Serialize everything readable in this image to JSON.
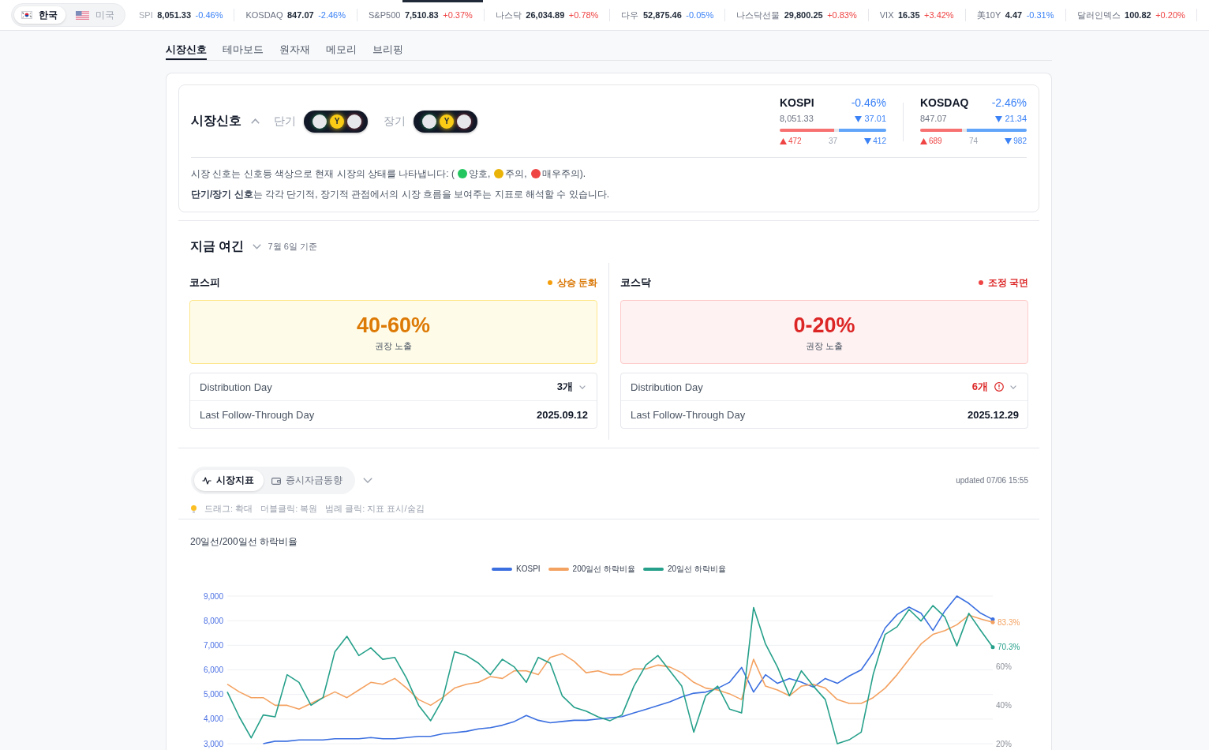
{
  "top_bar": {
    "regions": [
      {
        "label": "한국",
        "kind": "kr",
        "selected": true
      },
      {
        "label": "미국",
        "kind": "us",
        "selected": false
      }
    ],
    "ticker": [
      {
        "label": "SPI",
        "value": "8,051.33",
        "change": "-0.46%",
        "rising": false
      },
      {
        "label": "KOSDAQ",
        "value": "847.07",
        "change": "-2.46%",
        "rising": false
      },
      {
        "label": "S&P500",
        "value": "7,510.83",
        "change": "+0.37%",
        "rising": true
      },
      {
        "label": "나스닥",
        "value": "26,034.89",
        "change": "+0.78%",
        "rising": true
      },
      {
        "label": "다우",
        "value": "52,875.46",
        "change": "-0.05%",
        "rising": false
      },
      {
        "label": "나스닥선물",
        "value": "29,800.25",
        "change": "+0.83%",
        "rising": true
      },
      {
        "label": "VIX",
        "value": "16.35",
        "change": "+3.42%",
        "rising": true
      },
      {
        "label": "美10Y",
        "value": "4.47",
        "change": "-0.31%",
        "rising": false
      },
      {
        "label": "달러인덱스",
        "value": "100.82",
        "change": "+0.20%",
        "rising": true
      }
    ]
  },
  "tabs": [
    {
      "label": "시장신호",
      "selected": true
    },
    {
      "label": "테마보드",
      "selected": false
    },
    {
      "label": "원자재",
      "selected": false
    },
    {
      "label": "메모리",
      "selected": false
    },
    {
      "label": "브리핑",
      "selected": false
    }
  ],
  "market_signal": {
    "title": "시장신호",
    "expanded": true,
    "signals": [
      {
        "label": "단기",
        "lamps": [
          {
            "kind": "green",
            "on": false
          },
          {
            "kind": "yellow",
            "on": true,
            "letter": "Y"
          },
          {
            "kind": "red",
            "on": false
          }
        ]
      },
      {
        "label": "장기",
        "lamps": [
          {
            "kind": "green",
            "on": false
          },
          {
            "kind": "yellow",
            "on": true,
            "letter": "Y"
          },
          {
            "kind": "red",
            "on": false
          }
        ]
      }
    ],
    "indices": [
      {
        "name": "KOSPI",
        "change_percent": "-0.46%",
        "price": "8,051.33",
        "change": "37.01",
        "rising": false,
        "breadth": [
          {
            "kind": "up",
            "count": "472",
            "level": 0.51
          },
          {
            "kind": "flat",
            "count": "37"
          },
          {
            "kind": "down",
            "count": "412",
            "level": 0.445
          }
        ]
      },
      {
        "name": "KOSDAQ",
        "change_percent": "-2.46%",
        "price": "847.07",
        "change": "21.34",
        "rising": false,
        "breadth": [
          {
            "kind": "up",
            "count": "689",
            "level": 0.39
          },
          {
            "kind": "flat",
            "count": "74"
          },
          {
            "kind": "down",
            "count": "982",
            "level": 0.565
          }
        ]
      }
    ],
    "legend_intro": "시장 신호는 신호등 색상으로 현재 시장의 상태를 나타냅니다: (",
    "legend": [
      {
        "label": "양호,",
        "color": "#22c55e"
      },
      {
        "label": "주의,",
        "color": "#eab308"
      },
      {
        "label": "매우주의",
        "color": "#ef4444"
      }
    ],
    "legend_outro": ").",
    "note": "**단기/장기 신호**는 각각 단기적, 장기적 관점에서의 시장 흐름을 보여주는 지표로 해석할 수 있습니다."
  },
  "now": {
    "title": "지금 여긴",
    "date": "7월 6일 기준",
    "markets": [
      {
        "name": "코스피",
        "status": "상승 둔화",
        "kind": "caution",
        "range": "40-60%",
        "range_label": "권장 노출",
        "rows": [
          {
            "label": "Distribution Day",
            "value": "3개",
            "alert": false,
            "expandable": true
          },
          {
            "label": "Last Follow-Through Day",
            "value": "2025.09.12",
            "alert": false,
            "expandable": false
          }
        ]
      },
      {
        "name": "코스닥",
        "status": "조정 국면",
        "kind": "danger",
        "range": "0-20%",
        "range_label": "권장 노출",
        "rows": [
          {
            "label": "Distribution Day",
            "value": "6개",
            "alert": true,
            "expandable": true
          },
          {
            "label": "Last Follow-Through Day",
            "value": "2025.12.29",
            "alert": false,
            "expandable": false
          }
        ]
      }
    ]
  },
  "indicators": {
    "tabs": [
      {
        "label": "시장지표",
        "kind": "activity",
        "selected": true
      },
      {
        "label": "증시자금동향",
        "kind": "wallet",
        "selected": false
      }
    ],
    "updated": "updated 07/06 15:55",
    "hints": [
      "드래그: 확대",
      "더블클릭: 복원",
      "범례 클릭: 지표 표시/숨김"
    ],
    "chart_data": {
      "type": "line",
      "title": "20일선/200일선 하락비율",
      "legend": "top",
      "grid": true,
      "ylim": [
        3000,
        9000
      ],
      "yticks": [
        {
          "value": 3000,
          "label": "3,000"
        },
        {
          "value": 4000,
          "label": "4,000"
        },
        {
          "value": 5000,
          "label": "5,000"
        },
        {
          "value": 6000,
          "label": "6,000"
        },
        {
          "value": 7000,
          "label": "7,000"
        },
        {
          "value": 8000,
          "label": "8,000"
        },
        {
          "value": 9000,
          "label": "9,000"
        }
      ],
      "y2lim": [
        20,
        97
      ],
      "y2ticks": [
        {
          "value": 20,
          "label": "20%"
        },
        {
          "value": 40,
          "label": "40%"
        },
        {
          "value": 60,
          "label": "60%"
        }
      ],
      "series": [
        {
          "name": "KOSPI",
          "color": "#3b6fe0",
          "values": [
            null,
            null,
            null,
            3000,
            3100,
            3100,
            3150,
            3150,
            3150,
            3200,
            3200,
            3200,
            3250,
            3200,
            3200,
            3250,
            3300,
            3300,
            3400,
            3450,
            3500,
            3600,
            3650,
            3750,
            3900,
            4150,
            3950,
            3850,
            3900,
            3950,
            3950,
            4000,
            4050,
            4100,
            4250,
            4400,
            4550,
            4700,
            4900,
            5050,
            5100,
            5250,
            5500,
            6100,
            5100,
            5800,
            5450,
            5650,
            5500,
            5300,
            5650,
            5450,
            5750,
            6000,
            6700,
            7700,
            8250,
            8550,
            8300,
            7600,
            8400,
            9000,
            8700,
            8300,
            8050
          ]
        },
        {
          "name": "200일선 하락비율",
          "color": "#f4a261",
          "axis": "y2",
          "values": [
            51,
            47,
            44,
            44,
            40,
            40,
            38,
            41,
            44,
            47,
            44,
            48,
            52,
            51,
            54,
            49,
            43,
            40,
            44,
            49,
            51,
            52,
            55,
            54,
            58,
            58,
            56,
            65,
            67,
            63,
            57,
            58,
            56,
            56,
            59,
            59,
            61,
            60,
            57,
            52,
            49,
            48,
            46,
            43,
            64,
            50,
            48,
            45,
            50,
            51,
            49,
            43,
            41,
            41,
            44,
            49,
            56,
            64,
            72,
            77,
            79,
            82,
            87,
            85,
            83.3
          ]
        },
        {
          "name": "20일선 하락비율",
          "color": "#26a08a",
          "axis": "y2",
          "values": [
            47,
            34,
            23,
            35,
            34,
            56,
            52,
            40,
            44,
            68,
            76,
            66,
            70,
            64,
            65,
            54,
            40,
            32,
            43,
            68,
            66,
            62,
            56,
            64,
            60,
            52,
            65,
            62,
            45,
            39,
            37,
            34,
            32,
            35,
            50,
            61,
            66,
            58,
            50,
            26,
            45,
            50,
            38,
            36,
            91,
            72,
            60,
            45,
            58,
            50,
            43,
            20,
            22,
            26,
            56,
            77,
            81,
            90,
            84,
            92,
            86,
            71,
            88,
            79,
            70.3
          ]
        }
      ],
      "annotations": [
        "83.3%",
        "70.3%"
      ]
    }
  }
}
